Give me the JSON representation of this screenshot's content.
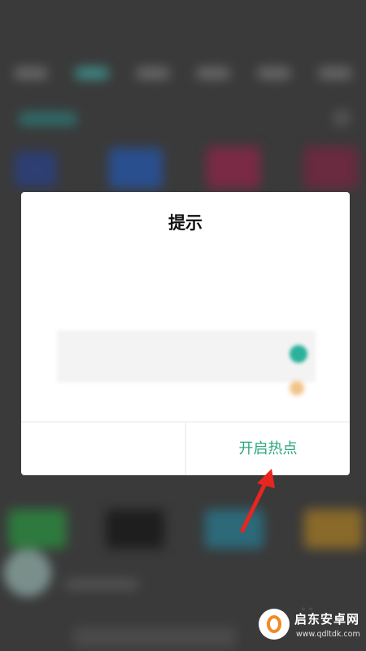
{
  "background": {
    "title": "",
    "tabs": [
      "",
      "",
      "",
      "",
      "",
      ""
    ],
    "active_tab_index": 1,
    "tile_colors": [
      "#2d3f73",
      "#2a4f8f",
      "#7a2a45",
      "#6a2a3f",
      "#2e7a3e",
      "#1e1e1e",
      "#2c6a7a",
      "#8a6a2a"
    ]
  },
  "dialog": {
    "title": "提示",
    "message": "",
    "setting_row_label": "",
    "cancel_label": "",
    "confirm_label": "开启热点",
    "confirm_color": "#2aa879"
  },
  "watermark": {
    "name": "启东安卓网",
    "url": "www.qdltdk.com"
  }
}
